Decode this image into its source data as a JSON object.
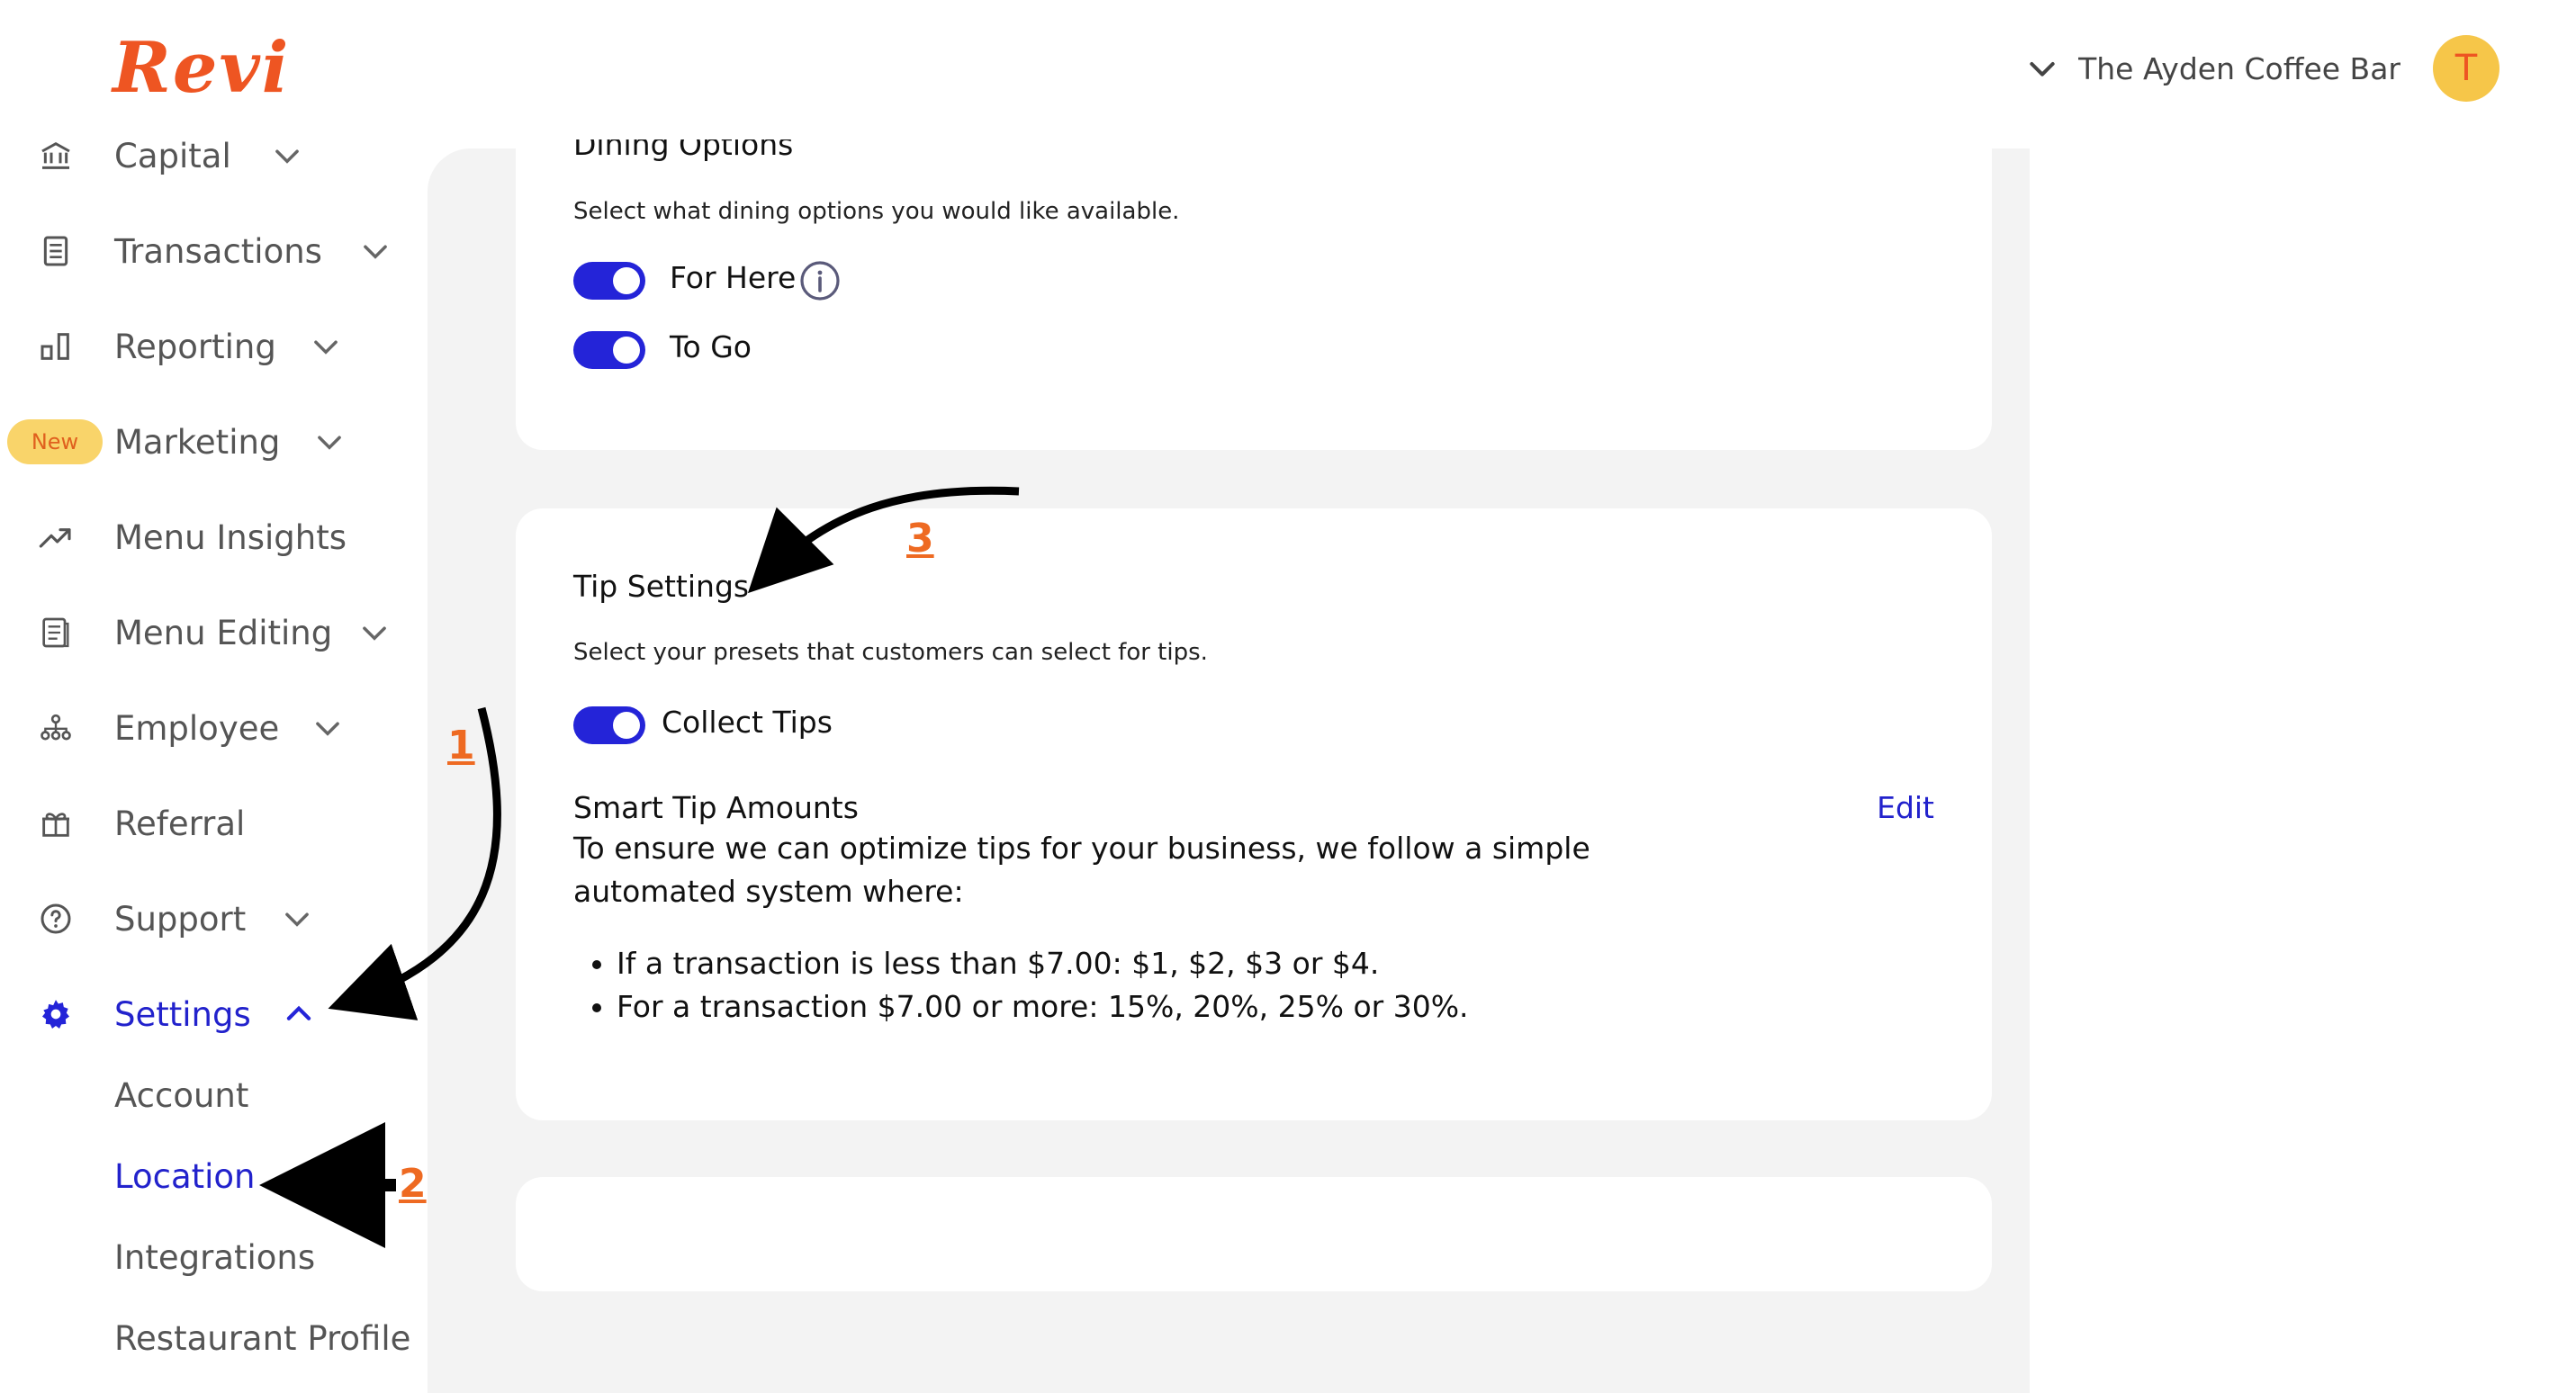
{
  "header": {
    "logo": "Revi",
    "business_name": "The Ayden Coffee Bar",
    "avatar_initial": "T"
  },
  "sidebar": {
    "items": [
      {
        "label": "Capital",
        "icon": "bank-icon"
      },
      {
        "label": "Transactions",
        "icon": "receipt-icon"
      },
      {
        "label": "Reporting",
        "icon": "bar-chart-icon"
      },
      {
        "label": "Marketing",
        "badge": "New"
      },
      {
        "label": "Menu Insights",
        "icon": "trend-up-icon"
      },
      {
        "label": "Menu Editing",
        "icon": "menu-card-icon"
      },
      {
        "label": "Employee",
        "icon": "org-chart-icon"
      },
      {
        "label": "Referral",
        "icon": "gift-icon"
      },
      {
        "label": "Support",
        "icon": "help-icon"
      },
      {
        "label": "Settings",
        "icon": "gear-icon"
      }
    ],
    "settings_subitems": [
      "Account",
      "Location",
      "Integrations",
      "Restaurant Profile"
    ]
  },
  "dining": {
    "title": "Dining Options",
    "description": "Select what dining options you would like available.",
    "options": [
      {
        "label": "For Here",
        "enabled": true
      },
      {
        "label": "To Go",
        "enabled": true
      }
    ]
  },
  "tips": {
    "title": "Tip Settings",
    "description": "Select your presets that customers can select for tips.",
    "collect_label": "Collect Tips",
    "smart_title": "Smart Tip Amounts",
    "edit_label": "Edit",
    "smart_text": "To ensure we can optimize tips for your business, we follow a simple automated system where:",
    "rules": [
      "If a transaction is less than $7.00: $1, $2, $3 or $4.",
      "For a transaction $7.00 or more: 15%, 20%, 25% or 30%."
    ]
  },
  "annotations": {
    "step1": "1",
    "step2": "2",
    "step3": "3"
  },
  "colors": {
    "brand": "#ee5522",
    "accent": "#2424d8",
    "annotation": "#ee6a22"
  }
}
